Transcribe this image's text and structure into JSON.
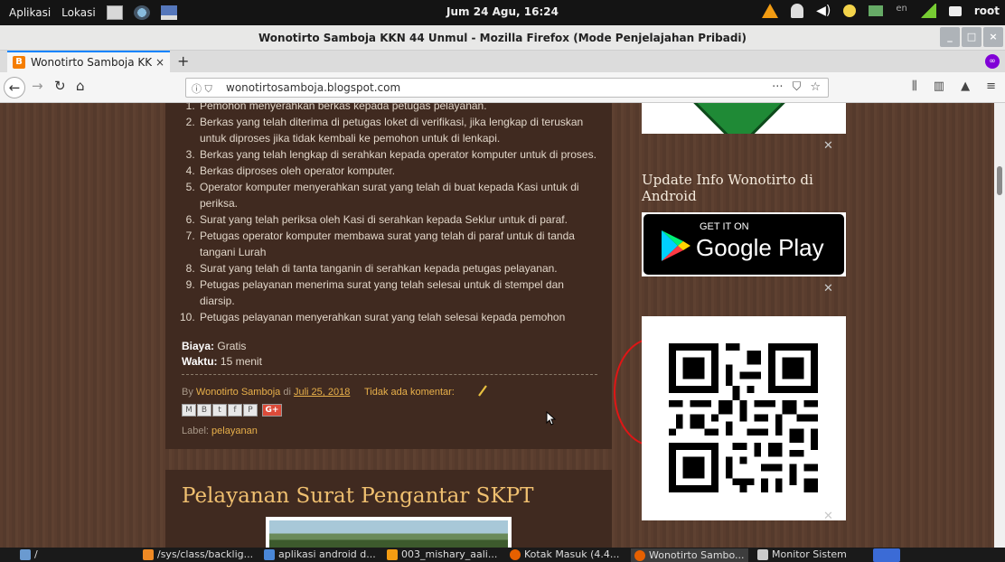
{
  "topbar": {
    "menu_apps": "Aplikasi",
    "menu_places": "Lokasi",
    "clock": "Jum 24 Agu, 16:24",
    "lang": "en",
    "user": "root"
  },
  "window": {
    "title": "Wonotirto Samboja KKN 44 Unmul - Mozilla Firefox (Mode Penjelajahan Pribadi)"
  },
  "tab": {
    "label": "Wonotirto Samboja KKN",
    "favicon": "B"
  },
  "navbar": {
    "url": "wonotirtosamboja.blogspot.com"
  },
  "post": {
    "steps": [
      "Pemohon menyerahkan berkas kepada  petugas pelayanan.",
      "Berkas yang telah diterima di petugas loket di verifikasi, jika lengkap di teruskan untuk diproses jika tidak kembali ke pemohon untuk di lenkapi.",
      "Berkas yang telah lengkap di serahkan kepada operator komputer untuk di proses.",
      "Berkas diproses oleh operator komputer.",
      "Operator komputer  menyerahkan surat yang telah di buat kepada Kasi untuk di periksa.",
      "Surat yang telah periksa oleh Kasi di serahkan kepada Seklur untuk di paraf.",
      "Petugas operator komputer membawa surat yang telah di paraf untuk di tanda tangani Lurah",
      "Surat yang telah di tanta tanganin di serahkan kepada petugas pelayanan.",
      "Petugas pelayanan menerima surat yang telah selesai untuk di stempel dan diarsip.",
      "Petugas pelayanan menyerahkan surat yang telah selesai kepada pemohon"
    ],
    "biaya_label": "Biaya:",
    "biaya_value": "Gratis",
    "waktu_label": "Waktu:",
    "waktu_value": "15 menit",
    "by": "By",
    "author": "Wonotirto Samboja",
    "di": "di",
    "date": "Juli 25, 2018",
    "comments": "Tidak ada komentar:",
    "label_prefix": "Label:",
    "label_value": "pelayanan",
    "share": [
      "M",
      "B",
      "t",
      "f",
      "P"
    ],
    "share_gplus": "G+"
  },
  "post2": {
    "title": "Pelayanan Surat Pengantar SKPT"
  },
  "sidebar": {
    "update_title": "Update Info Wonotirto di Android",
    "gplay_small": "GET IT ON",
    "gplay_big": "Google Play"
  },
  "taskbar": {
    "items": [
      "/",
      "/sys/class/backlig...",
      "aplikasi android d...",
      "003_mishary_aali...",
      "Kotak Masuk (4.4...",
      "Wonotirto Sambo...",
      "Monitor Sistem"
    ]
  }
}
